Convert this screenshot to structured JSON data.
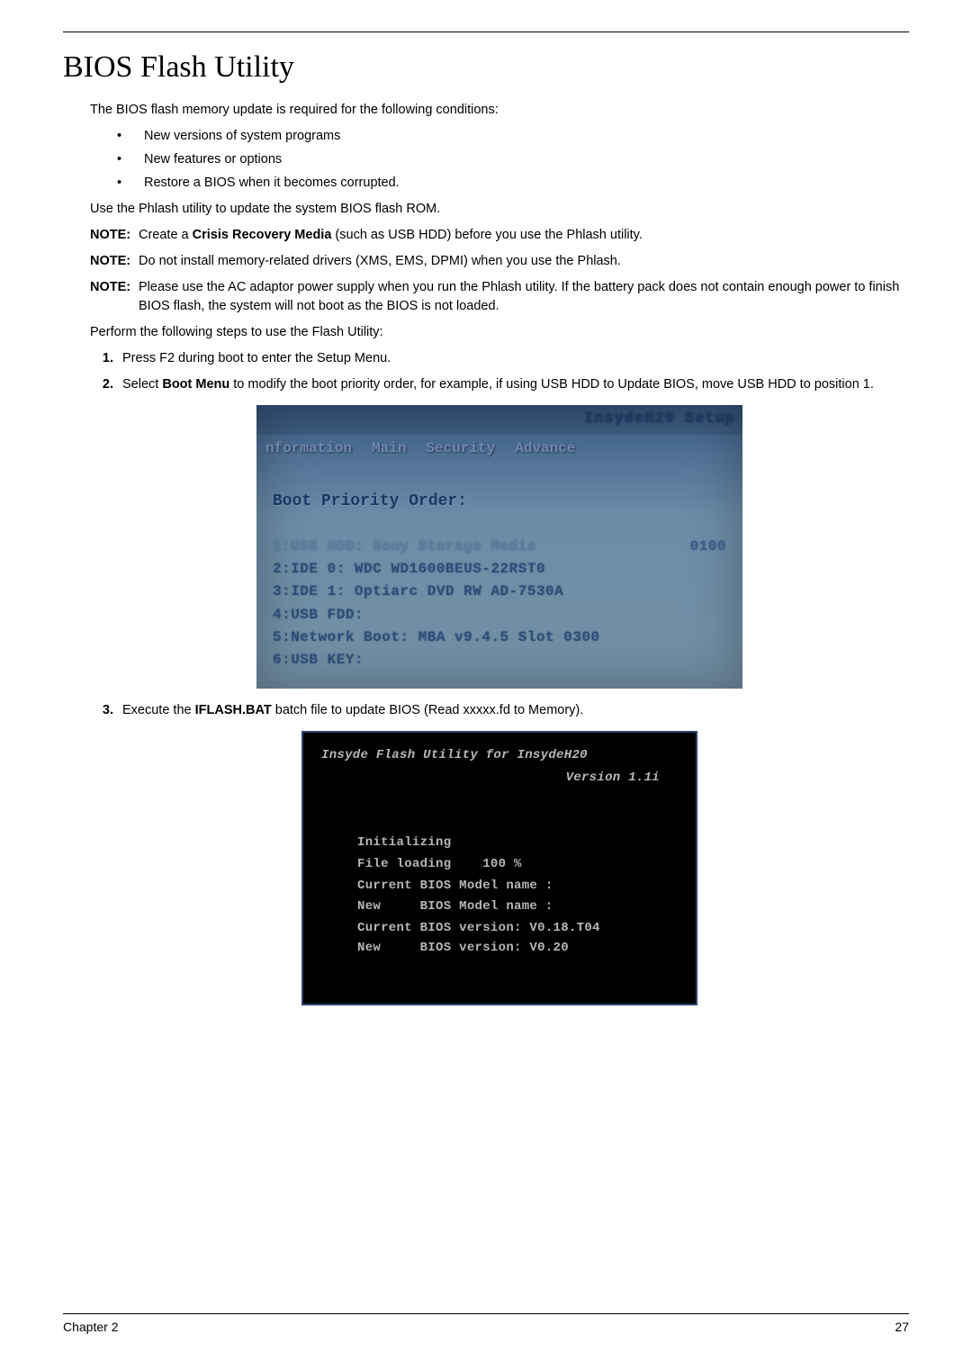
{
  "title": "BIOS Flash Utility",
  "intro": "The BIOS flash memory update is required for the following conditions:",
  "bullets": [
    "New versions of system programs",
    "New features or options",
    "Restore a BIOS when it becomes corrupted."
  ],
  "use_line": "Use the Phlash utility to update the system BIOS flash ROM.",
  "notes": [
    {
      "label": "NOTE:",
      "pre": "Create a ",
      "bold": "Crisis Recovery Media",
      "post": " (such as USB HDD) before you use the Phlash utility."
    },
    {
      "label": "NOTE:",
      "pre": "Do not install memory-related drivers (XMS, EMS, DPMI) when you use the Phlash.",
      "bold": "",
      "post": ""
    },
    {
      "label": "NOTE:",
      "pre": "Please use the AC adaptor power supply when you run the Phlash utility. If the battery pack does not contain enough power to finish BIOS flash, the system will not boot as the BIOS is not loaded.",
      "bold": "",
      "post": ""
    }
  ],
  "perform": "Perform the following steps to use the Flash Utility:",
  "steps": [
    {
      "pre": "Press F2 during boot to enter the Setup Menu.",
      "bold": "",
      "post": ""
    },
    {
      "pre": "Select ",
      "bold": "Boot Menu",
      "post": " to modify the boot priority order, for example, if using USB HDD to Update BIOS, move USB HDD to position 1."
    }
  ],
  "bios1": {
    "top": "InsydeH20 Setup",
    "tabs": [
      "nformation",
      "Main",
      "Security",
      "Advance"
    ],
    "header": "Boot Priority Order:",
    "lines": [
      {
        "txt": "1:USB HDD: Sony    Storage Media",
        "rt": "0100",
        "sel": true
      },
      {
        "txt": "2:IDE 0: WDC WD1600BEUS-22RST0",
        "rt": "",
        "sel": false
      },
      {
        "txt": "3:IDE 1: Optiarc DVD RW AD-7530A",
        "rt": "",
        "sel": false
      },
      {
        "txt": "4:USB FDD:",
        "rt": "",
        "sel": false
      },
      {
        "txt": "5:Network Boot: MBA v9.4.5  Slot 0300",
        "rt": "",
        "sel": false
      },
      {
        "txt": "6:USB KEY:",
        "rt": "",
        "sel": false
      }
    ]
  },
  "step3": {
    "pre": "Execute the ",
    "bold": "IFLASH.BAT",
    "post": " batch file to update BIOS (Read xxxxx.fd to Memory)."
  },
  "bios2": {
    "title": "Insyde Flash Utility for InsydeH20",
    "version": "Version 1.1i",
    "lines": [
      "Initializing",
      "",
      "File loading    100 %",
      "",
      "Current BIOS Model name :",
      "New     BIOS Model name :",
      "",
      "Current BIOS version: V0.18.T04",
      "New     BIOS version: V0.20"
    ]
  },
  "footer_left": "Chapter 2",
  "footer_right": "27"
}
